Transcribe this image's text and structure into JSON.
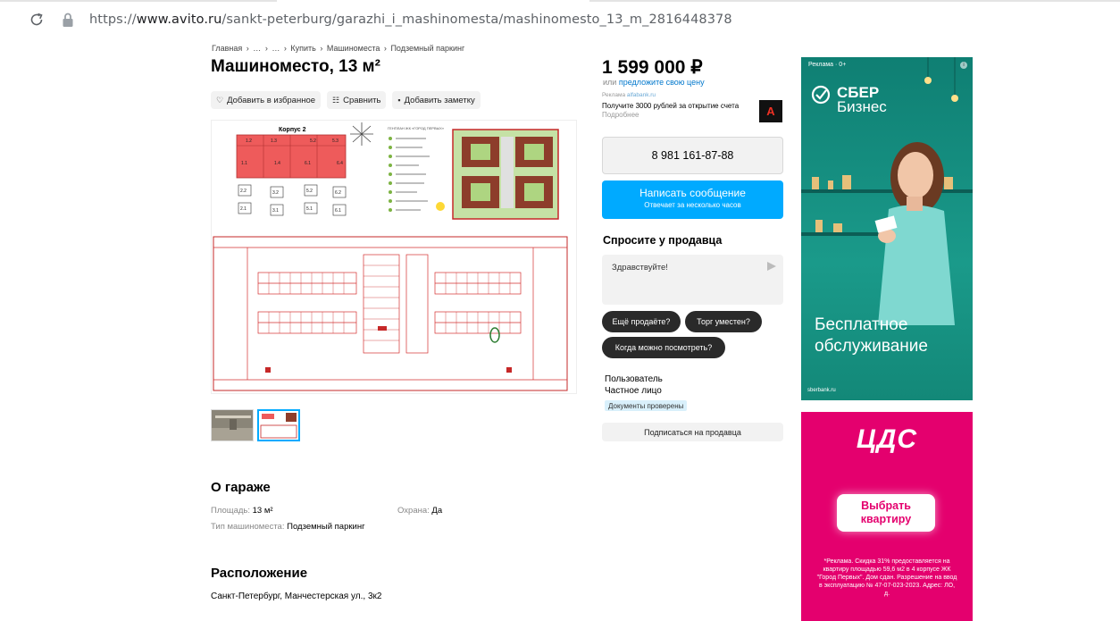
{
  "browser": {
    "url_prefix": "https://",
    "url_host": "www.avito.ru",
    "url_path": "/sankt-peterburg/garazhi_i_mashinomesta/mashinomesto_13_m_2816448378"
  },
  "breadcrumbs": [
    "Главная",
    "›",
    "…",
    "›",
    "…",
    "›",
    "Купить",
    "›",
    "Машиноместа",
    "›",
    "Подземный паркинг"
  ],
  "listing": {
    "title": "Машиноместо, 13 м²",
    "actions": {
      "favorite": "Добавить в избранное",
      "compare": "Сравнить",
      "note": "Добавить заметку"
    },
    "plan": {
      "building_label": "Корпус 2",
      "legend_title": "ГЕНПЛАН ЖК «ГОРОД ПЕРВЫХ»",
      "units": [
        "1.2",
        "1.3",
        "5.2",
        "5.3",
        "1.1",
        "1.4",
        "6.1",
        "6.4",
        "2.2",
        "3.2",
        "5.2",
        "6.2",
        "2.1",
        "3.1",
        "5.1",
        "6.1"
      ]
    }
  },
  "about": {
    "title": "О гараже",
    "area_label": "Площадь:",
    "area_value": "13 м²",
    "security_label": "Охрана:",
    "security_value": "Да",
    "type_label": "Тип машиноместа:",
    "type_value": "Подземный паркинг"
  },
  "location": {
    "title": "Расположение",
    "address": "Санкт-Петербург, Манчестерская ул., 3к2"
  },
  "sidebar": {
    "price": "1 599 000 ₽",
    "offer_prefix": "или",
    "offer_link": "предложите свою цену",
    "promo_label": "Реклама",
    "promo_domain": "alfabank.ru",
    "promo_text": "Получите 3000 рублей за открытие счета",
    "promo_more": "Подробнее",
    "promo_logo": "A",
    "phone": "8 981 161-87-88",
    "message_btn": "Написать сообщение",
    "message_sub": "Отвечает за несколько часов",
    "ask_title": "Спросите у продавца",
    "ask_placeholder": "Здравствуйте!",
    "chips": [
      "Ещё продаёте?",
      "Торг уместен?",
      "Когда можно посмотреть?"
    ],
    "seller_name": "Пользователь",
    "seller_type": "Частное лицо",
    "docs_badge": "Документы проверены",
    "subscribe_btn": "Подписаться на продавца"
  },
  "ads": {
    "sber": {
      "label": "Реклама · 0+",
      "info": "i",
      "brand_line1": "СБЕР",
      "brand_line2": "Бизнес",
      "tagline_line1": "Бесплатное",
      "tagline_line2": "обслуживание",
      "footer": "sberbank.ru",
      "color": "#1a9a8a"
    },
    "cds": {
      "logo": "ЦДС",
      "btn_line1": "Выбрать",
      "btn_line2": "квартиру",
      "disclaimer": "*Реклама. Скидка 31% предоставляется на квартиру площадью 59,6 м2 в 4 корпусе ЖК \"Город Первых\". Дом сдан. Разрешение на ввод в эксплуатацию № 47-07-023-2023. Адрес: ЛО, д.",
      "color": "#e4006e"
    }
  }
}
